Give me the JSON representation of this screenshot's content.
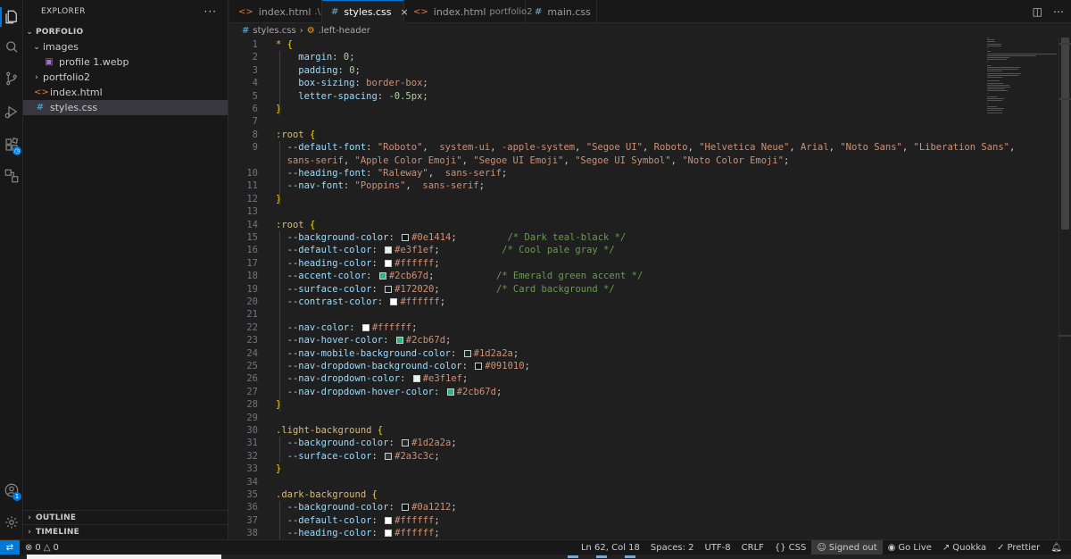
{
  "activity": {
    "explorer_icon": "files-icon",
    "search_icon": "search-icon",
    "scm_icon": "source-control-icon",
    "debug_icon": "run-debug-icon",
    "extensions_icon": "extensions-icon",
    "remote_icon": "remote-explorer-icon",
    "accounts_icon": "account-icon",
    "accounts_badge": "1",
    "settings_icon": "gear-icon"
  },
  "sidebar": {
    "title": "EXPLORER",
    "more": "···",
    "root": "PORFOLIO",
    "items": [
      {
        "label": "images",
        "type": "folder-open",
        "indent": 1
      },
      {
        "label": "profile 1.webp",
        "type": "image",
        "indent": 2
      },
      {
        "label": "portfolio2",
        "type": "folder-closed",
        "indent": 1
      },
      {
        "label": "index.html",
        "type": "html",
        "indent": 1
      },
      {
        "label": "styles.css",
        "type": "css",
        "indent": 1,
        "selected": true
      }
    ],
    "outline": "OUTLINE",
    "timeline": "TIMELINE"
  },
  "tabs": [
    {
      "label": "index.html",
      "desc": ".\\",
      "type": "html",
      "active": false
    },
    {
      "label": "styles.css",
      "desc": "",
      "type": "css",
      "active": true,
      "close": "×"
    },
    {
      "label": "index.html",
      "desc": "portfolio2",
      "type": "html",
      "active": false
    },
    {
      "label": "main.css",
      "desc": "",
      "type": "css",
      "active": false
    }
  ],
  "breadcrumb": {
    "file": "styles.css",
    "separator": "›",
    "symbol": ".left-header"
  },
  "code_lines": [
    {
      "n": "1",
      "tokens": [
        [
          "c-sel",
          "* "
        ],
        [
          "c-brace",
          "{"
        ]
      ]
    },
    {
      "n": "2",
      "tokens": [
        [
          "c-prop",
          "    margin"
        ],
        [
          "c-plain",
          ": "
        ],
        [
          "c-num",
          "0"
        ],
        [
          "c-plain",
          ";"
        ]
      ]
    },
    {
      "n": "3",
      "tokens": [
        [
          "c-prop",
          "    padding"
        ],
        [
          "c-plain",
          ": "
        ],
        [
          "c-num",
          "0"
        ],
        [
          "c-plain",
          ";"
        ]
      ]
    },
    {
      "n": "4",
      "tokens": [
        [
          "c-prop",
          "    box-sizing"
        ],
        [
          "c-plain",
          ": "
        ],
        [
          "c-val",
          "border-box"
        ],
        [
          "c-plain",
          ";"
        ]
      ]
    },
    {
      "n": "5",
      "tokens": [
        [
          "c-prop",
          "    letter-spacing"
        ],
        [
          "c-plain",
          ": "
        ],
        [
          "c-num",
          "-0.5px"
        ],
        [
          "c-plain",
          ";"
        ]
      ]
    },
    {
      "n": "6",
      "tokens": [
        [
          "c-brace",
          "}"
        ]
      ]
    },
    {
      "n": "7",
      "tokens": []
    },
    {
      "n": "8",
      "tokens": [
        [
          "c-sel",
          ":root "
        ],
        [
          "c-brace",
          "{"
        ]
      ]
    },
    {
      "n": "9",
      "tokens": [
        [
          "c-prop",
          "  --default-font"
        ],
        [
          "c-plain",
          ": "
        ],
        [
          "c-str",
          "\"Roboto\""
        ],
        [
          "c-plain",
          ",  "
        ],
        [
          "c-val",
          "system-ui"
        ],
        [
          "c-plain",
          ", "
        ],
        [
          "c-val",
          "-apple-system"
        ],
        [
          "c-plain",
          ", "
        ],
        [
          "c-str",
          "\"Segoe UI\""
        ],
        [
          "c-plain",
          ", "
        ],
        [
          "c-val",
          "Roboto"
        ],
        [
          "c-plain",
          ", "
        ],
        [
          "c-str",
          "\"Helvetica Neue\""
        ],
        [
          "c-plain",
          ", "
        ],
        [
          "c-val",
          "Arial"
        ],
        [
          "c-plain",
          ", "
        ],
        [
          "c-str",
          "\"Noto Sans\""
        ],
        [
          "c-plain",
          ", "
        ],
        [
          "c-str",
          "\"Liberation Sans\""
        ],
        [
          "c-plain",
          ","
        ]
      ]
    },
    {
      "n": "",
      "tokens": [
        [
          "c-val",
          "  sans-serif"
        ],
        [
          "c-plain",
          ", "
        ],
        [
          "c-str",
          "\"Apple Color Emoji\""
        ],
        [
          "c-plain",
          ", "
        ],
        [
          "c-str",
          "\"Segoe UI Emoji\""
        ],
        [
          "c-plain",
          ", "
        ],
        [
          "c-str",
          "\"Segoe UI Symbol\""
        ],
        [
          "c-plain",
          ", "
        ],
        [
          "c-str",
          "\"Noto Color Emoji\""
        ],
        [
          "c-plain",
          ";"
        ]
      ]
    },
    {
      "n": "10",
      "tokens": [
        [
          "c-prop",
          "  --heading-font"
        ],
        [
          "c-plain",
          ": "
        ],
        [
          "c-str",
          "\"Raleway\""
        ],
        [
          "c-plain",
          ",  "
        ],
        [
          "c-val",
          "sans-serif"
        ],
        [
          "c-plain",
          ";"
        ]
      ]
    },
    {
      "n": "11",
      "tokens": [
        [
          "c-prop",
          "  --nav-font"
        ],
        [
          "c-plain",
          ": "
        ],
        [
          "c-str",
          "\"Poppins\""
        ],
        [
          "c-plain",
          ",  "
        ],
        [
          "c-val",
          "sans-serif"
        ],
        [
          "c-plain",
          ";"
        ]
      ]
    },
    {
      "n": "12",
      "tokens": [
        [
          "c-brace",
          "}"
        ]
      ]
    },
    {
      "n": "13",
      "tokens": []
    },
    {
      "n": "14",
      "tokens": [
        [
          "c-sel",
          ":root "
        ],
        [
          "c-brace",
          "{"
        ]
      ]
    },
    {
      "n": "15",
      "tokens": [
        [
          "c-prop",
          "  --background-color"
        ],
        [
          "c-plain",
          ": "
        ],
        [
          "sw",
          "#0e1414"
        ],
        [
          "c-val",
          "#0e1414"
        ],
        [
          "c-plain",
          ";         "
        ],
        [
          "c-com",
          "/* Dark teal-black */"
        ]
      ]
    },
    {
      "n": "16",
      "tokens": [
        [
          "c-prop",
          "  --default-color"
        ],
        [
          "c-plain",
          ": "
        ],
        [
          "sw",
          "#e3f1ef"
        ],
        [
          "c-val",
          "#e3f1ef"
        ],
        [
          "c-plain",
          ";           "
        ],
        [
          "c-com",
          "/* Cool pale gray */"
        ]
      ]
    },
    {
      "n": "17",
      "tokens": [
        [
          "c-prop",
          "  --heading-color"
        ],
        [
          "c-plain",
          ": "
        ],
        [
          "sw",
          "#ffffff"
        ],
        [
          "c-val",
          "#ffffff"
        ],
        [
          "c-plain",
          ";"
        ]
      ]
    },
    {
      "n": "18",
      "tokens": [
        [
          "c-prop",
          "  --accent-color"
        ],
        [
          "c-plain",
          ": "
        ],
        [
          "sw",
          "#2cb67d"
        ],
        [
          "c-val",
          "#2cb67d"
        ],
        [
          "c-plain",
          ";           "
        ],
        [
          "c-com",
          "/* Emerald green accent */"
        ]
      ]
    },
    {
      "n": "19",
      "tokens": [
        [
          "c-prop",
          "  --surface-color"
        ],
        [
          "c-plain",
          ": "
        ],
        [
          "sw",
          "#172020"
        ],
        [
          "c-val",
          "#172020"
        ],
        [
          "c-plain",
          ";          "
        ],
        [
          "c-com",
          "/* Card background */"
        ]
      ]
    },
    {
      "n": "20",
      "tokens": [
        [
          "c-prop",
          "  --contrast-color"
        ],
        [
          "c-plain",
          ": "
        ],
        [
          "sw",
          "#ffffff"
        ],
        [
          "c-val",
          "#ffffff"
        ],
        [
          "c-plain",
          ";"
        ]
      ]
    },
    {
      "n": "21",
      "tokens": []
    },
    {
      "n": "22",
      "tokens": [
        [
          "c-prop",
          "  --nav-color"
        ],
        [
          "c-plain",
          ": "
        ],
        [
          "sw",
          "#ffffff"
        ],
        [
          "c-val",
          "#ffffff"
        ],
        [
          "c-plain",
          ";"
        ]
      ]
    },
    {
      "n": "23",
      "tokens": [
        [
          "c-prop",
          "  --nav-hover-color"
        ],
        [
          "c-plain",
          ": "
        ],
        [
          "sw",
          "#2cb67d"
        ],
        [
          "c-val",
          "#2cb67d"
        ],
        [
          "c-plain",
          ";"
        ]
      ]
    },
    {
      "n": "24",
      "tokens": [
        [
          "c-prop",
          "  --nav-mobile-background-color"
        ],
        [
          "c-plain",
          ": "
        ],
        [
          "sw",
          "#1d2a2a"
        ],
        [
          "c-val",
          "#1d2a2a"
        ],
        [
          "c-plain",
          ";"
        ]
      ]
    },
    {
      "n": "25",
      "tokens": [
        [
          "c-prop",
          "  --nav-dropdown-background-color"
        ],
        [
          "c-plain",
          ": "
        ],
        [
          "sw",
          "#091010"
        ],
        [
          "c-val",
          "#091010"
        ],
        [
          "c-plain",
          ";"
        ]
      ]
    },
    {
      "n": "26",
      "tokens": [
        [
          "c-prop",
          "  --nav-dropdown-color"
        ],
        [
          "c-plain",
          ": "
        ],
        [
          "sw",
          "#e3f1ef"
        ],
        [
          "c-val",
          "#e3f1ef"
        ],
        [
          "c-plain",
          ";"
        ]
      ]
    },
    {
      "n": "27",
      "tokens": [
        [
          "c-prop",
          "  --nav-dropdown-hover-color"
        ],
        [
          "c-plain",
          ": "
        ],
        [
          "sw",
          "#2cb67d"
        ],
        [
          "c-val",
          "#2cb67d"
        ],
        [
          "c-plain",
          ";"
        ]
      ]
    },
    {
      "n": "28",
      "tokens": [
        [
          "c-brace",
          "}"
        ]
      ]
    },
    {
      "n": "29",
      "tokens": []
    },
    {
      "n": "30",
      "tokens": [
        [
          "c-sel",
          ".light-background "
        ],
        [
          "c-brace",
          "{"
        ]
      ]
    },
    {
      "n": "31",
      "tokens": [
        [
          "c-prop",
          "  --background-color"
        ],
        [
          "c-plain",
          ": "
        ],
        [
          "sw",
          "#1d2a2a"
        ],
        [
          "c-val",
          "#1d2a2a"
        ],
        [
          "c-plain",
          ";"
        ]
      ]
    },
    {
      "n": "32",
      "tokens": [
        [
          "c-prop",
          "  --surface-color"
        ],
        [
          "c-plain",
          ": "
        ],
        [
          "sw",
          "#2a3c3c"
        ],
        [
          "c-val",
          "#2a3c3c"
        ],
        [
          "c-plain",
          ";"
        ]
      ]
    },
    {
      "n": "33",
      "tokens": [
        [
          "c-brace",
          "}"
        ]
      ]
    },
    {
      "n": "34",
      "tokens": []
    },
    {
      "n": "35",
      "tokens": [
        [
          "c-sel",
          ".dark-background "
        ],
        [
          "c-brace",
          "{"
        ]
      ]
    },
    {
      "n": "36",
      "tokens": [
        [
          "c-prop",
          "  --background-color"
        ],
        [
          "c-plain",
          ": "
        ],
        [
          "sw",
          "#0a1212"
        ],
        [
          "c-val",
          "#0a1212"
        ],
        [
          "c-plain",
          ";"
        ]
      ]
    },
    {
      "n": "37",
      "tokens": [
        [
          "c-prop",
          "  --default-color"
        ],
        [
          "c-plain",
          ": "
        ],
        [
          "sw",
          "#ffffff"
        ],
        [
          "c-val",
          "#ffffff"
        ],
        [
          "c-plain",
          ";"
        ]
      ]
    },
    {
      "n": "38",
      "tokens": [
        [
          "c-prop",
          "  --heading-color"
        ],
        [
          "c-plain",
          ": "
        ],
        [
          "sw",
          "#ffffff"
        ],
        [
          "c-val",
          "#ffffff"
        ],
        [
          "c-plain",
          ";"
        ]
      ]
    }
  ],
  "status": {
    "remote_icon": "remote-icon",
    "errors": "0",
    "warnings": "0",
    "position": "Ln 62, Col 18",
    "spaces": "Spaces: 2",
    "encoding": "UTF-8",
    "eol": "CRLF",
    "language": "CSS",
    "signed": "Signed out",
    "golive": "Go Live",
    "quokka": "Quokka",
    "prettier": "Prettier"
  },
  "colors": {
    "accent": "#0078d4",
    "bg": "#1f1f1f",
    "sidebar": "#181818"
  }
}
